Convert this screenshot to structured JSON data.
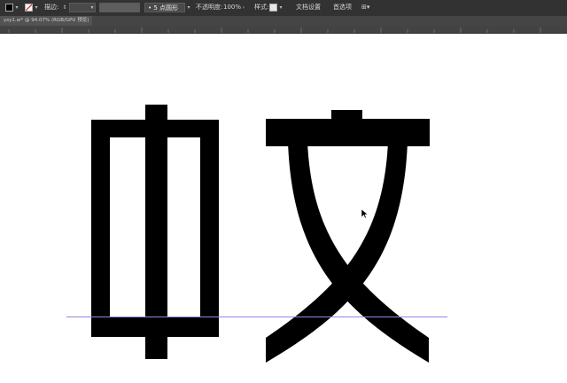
{
  "control_bar": {
    "fill_icon": "square-fill-icon",
    "stroke_icon": "slash-no-stroke-icon",
    "stroke_label": "描边:",
    "brush_label": "5 点圆形",
    "opacity_label": "不透明度:",
    "opacity_value": "100%",
    "style_label": "样式:",
    "document_setup_label": "文档设置",
    "preferences_label": "首选项"
  },
  "document": {
    "tab_title": "ysy1.ai* @ 94.07% (RGB/GPU 预览)"
  },
  "artwork": {
    "glyphs": [
      "中",
      "文"
    ],
    "fill_color": "#000000",
    "guide_color": "#8c8ce0"
  }
}
